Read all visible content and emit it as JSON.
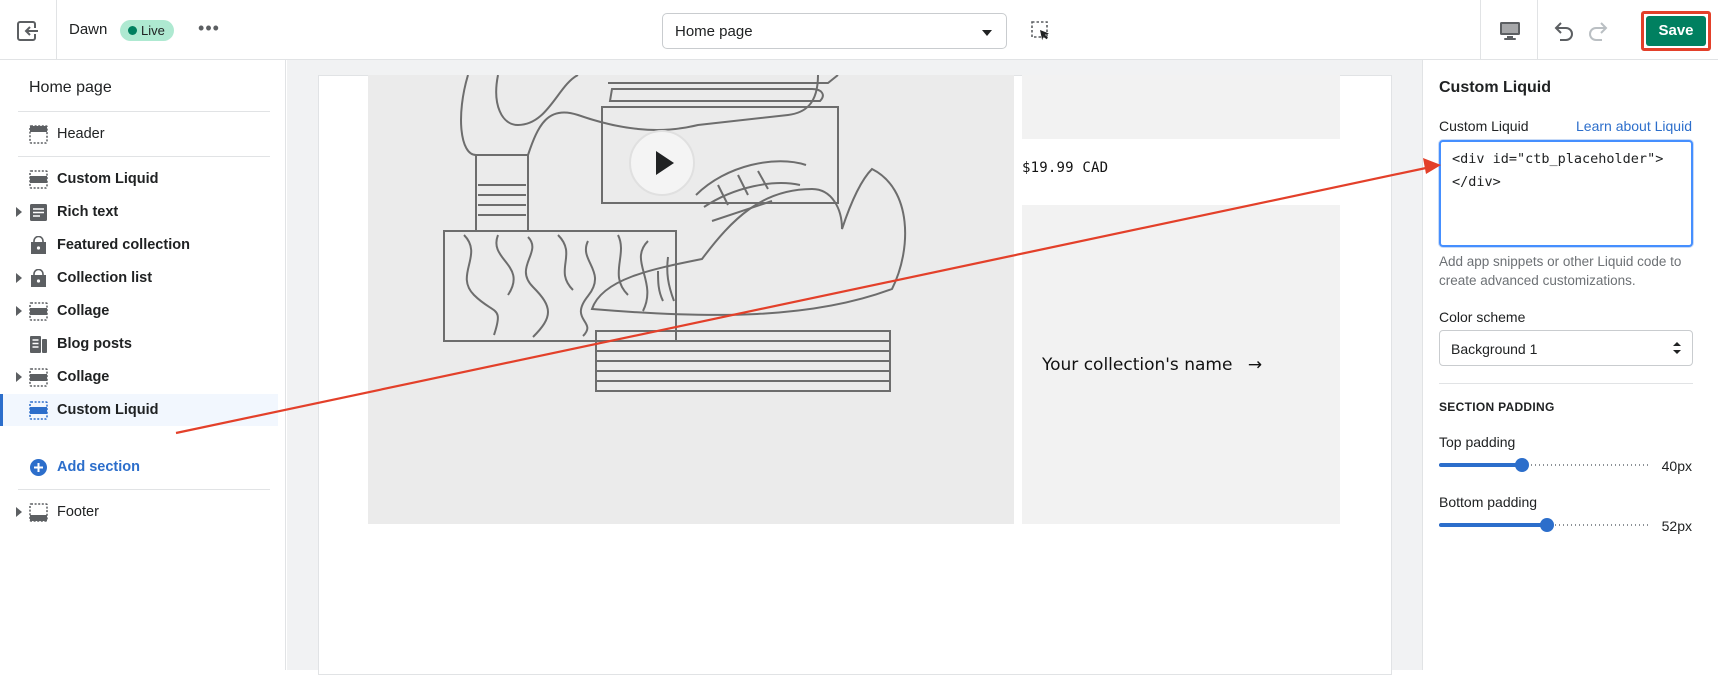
{
  "topbar": {
    "theme_name": "Dawn",
    "live_badge": "Live",
    "more_label": "•••",
    "page_select": "Home page",
    "save_label": "Save"
  },
  "sidebar": {
    "title": "Home page",
    "header_item": "Header",
    "items": [
      {
        "label": "Custom Liquid",
        "icon": "section-icon",
        "has_arrow": false
      },
      {
        "label": "Rich text",
        "icon": "text-block-icon",
        "has_arrow": true
      },
      {
        "label": "Featured collection",
        "icon": "tag-icon",
        "has_arrow": false
      },
      {
        "label": "Collection list",
        "icon": "tag-icon",
        "has_arrow": true
      },
      {
        "label": "Collage",
        "icon": "section-icon",
        "has_arrow": true
      },
      {
        "label": "Blog posts",
        "icon": "blog-icon",
        "has_arrow": false
      },
      {
        "label": "Collage",
        "icon": "section-icon",
        "has_arrow": true
      },
      {
        "label": "Custom Liquid",
        "icon": "section-icon",
        "has_arrow": false
      }
    ],
    "add_section": "Add section",
    "footer_item": "Footer"
  },
  "preview": {
    "price": "$19.99 CAD",
    "collection_name": "Your collection's name",
    "collection_arrow": "→"
  },
  "panel": {
    "title": "Custom Liquid",
    "field_label": "Custom Liquid",
    "learn_link": "Learn about Liquid",
    "code_line_1": "<div id=\"ctb_placeholder\">",
    "code_line_2": "</div>",
    "help_text": "Add app snippets or other Liquid code to create advanced customizations.",
    "color_scheme_label": "Color scheme",
    "color_scheme_value": "Background 1",
    "section_padding": "SECTION PADDING",
    "top_padding_label": "Top padding",
    "top_padding_value": "40px",
    "top_padding_fraction": 0.4,
    "bottom_padding_label": "Bottom padding",
    "bottom_padding_value": "52px",
    "bottom_padding_fraction": 0.52
  },
  "colors": {
    "accent": "#2c6ecb",
    "save_green": "#008060",
    "annotation_red": "#e3402a",
    "live_badge_bg": "#aee9d1"
  }
}
